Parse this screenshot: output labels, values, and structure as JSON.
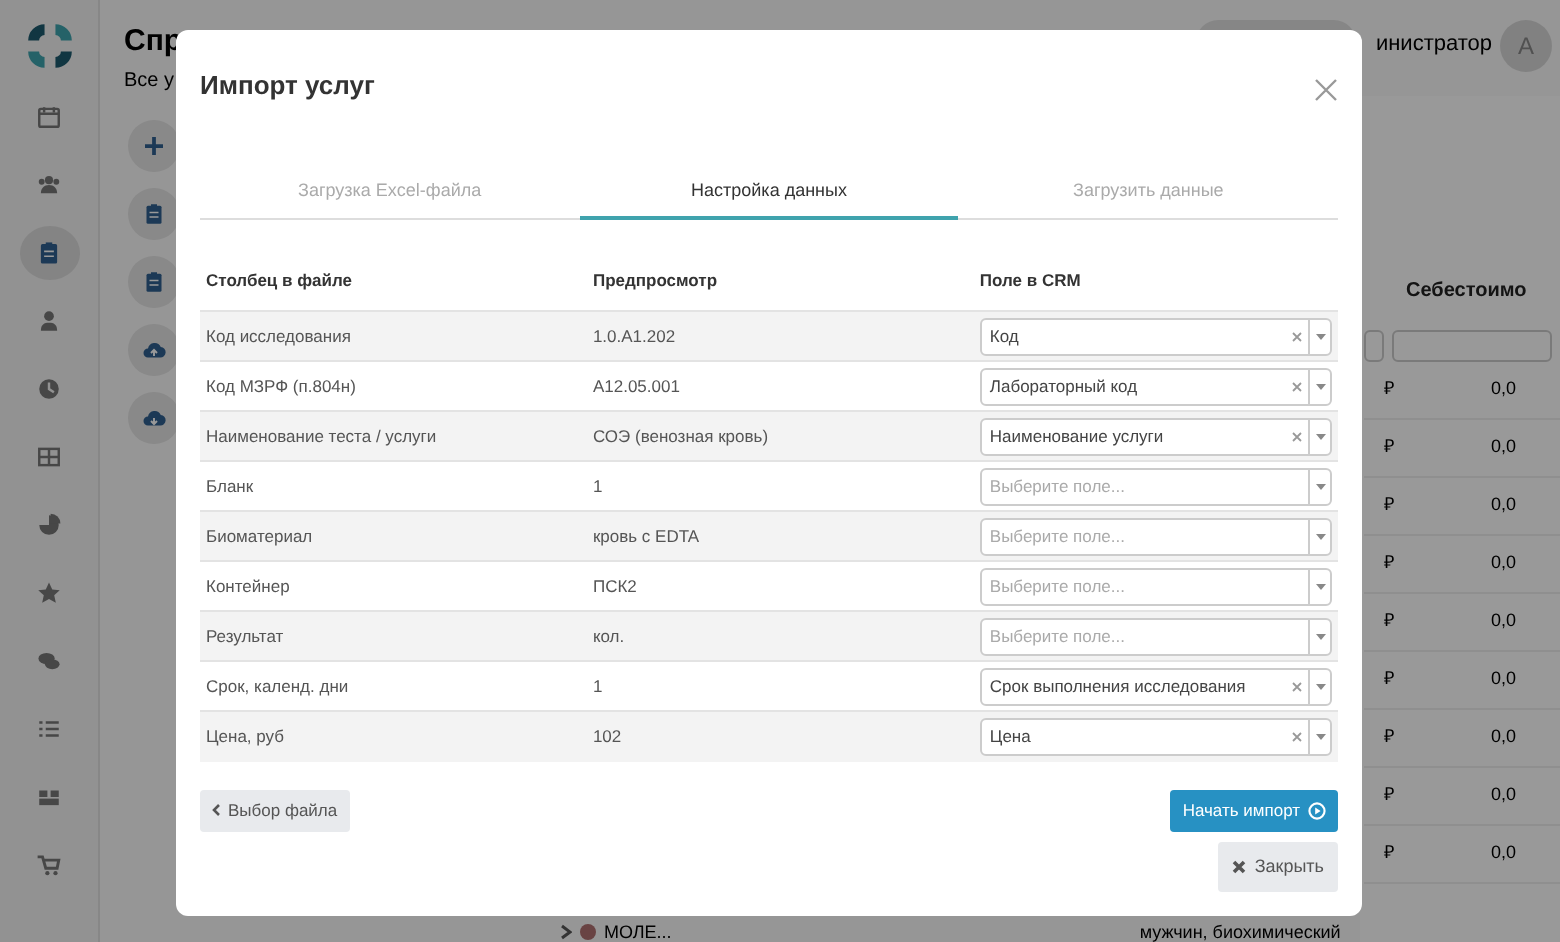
{
  "sidebar": {
    "items": [
      {
        "selected": false
      },
      {
        "selected": false
      },
      {
        "selected": true
      },
      {
        "selected": false
      },
      {
        "selected": false
      },
      {
        "selected": false
      },
      {
        "selected": false
      },
      {
        "selected": false
      },
      {
        "selected": false
      },
      {
        "selected": false
      },
      {
        "selected": false
      },
      {
        "selected": false
      }
    ]
  },
  "page": {
    "title": "Спр",
    "subtitle": "Все у"
  },
  "user": {
    "name": "инистратор",
    "avatar": "A"
  },
  "table": {
    "column_header": "Себестоимо",
    "rows": [
      {
        "currency": "₽",
        "value": "0,0"
      },
      {
        "currency": "₽",
        "value": "0,0"
      },
      {
        "currency": "₽",
        "value": "0,0"
      },
      {
        "currency": "₽",
        "value": "0,0"
      },
      {
        "currency": "₽",
        "value": "0,0"
      },
      {
        "currency": "₽",
        "value": "0,0"
      },
      {
        "currency": "₽",
        "value": "0,0"
      },
      {
        "currency": "₽",
        "value": "0,0"
      },
      {
        "currency": "₽",
        "value": "0,0"
      }
    ],
    "footer": {
      "tag": "МОЛЕ...",
      "description": "мужчин, биохимический"
    }
  },
  "modal": {
    "title": "Импорт услуг",
    "tabs": [
      {
        "label": "Загрузка Excel-файла",
        "selected": false
      },
      {
        "label": "Настройка данных",
        "selected": true
      },
      {
        "label": "Загрузить данные",
        "selected": false
      }
    ],
    "columns": [
      "Столбец в файле",
      "Предпросмотр",
      "Поле в CRM"
    ],
    "rows": [
      {
        "column": "Код исследования",
        "preview": "1.0.A1.202",
        "field": {
          "value": "Код"
        }
      },
      {
        "column": "Код МЗРФ (п.804н)",
        "preview": "A12.05.001",
        "field": {
          "value": "Лабораторный код"
        }
      },
      {
        "column": "Наименование теста / услуги",
        "preview": "СОЭ (венозная кровь)",
        "field": {
          "value": "Наименование услуги"
        }
      },
      {
        "column": "Бланк",
        "preview": "1",
        "field": {
          "placeholder": "Выберите поле..."
        }
      },
      {
        "column": "Биоматериал",
        "preview": "кровь с EDTA",
        "field": {
          "placeholder": "Выберите поле..."
        }
      },
      {
        "column": "Контейнер",
        "preview": "ПСК2",
        "field": {
          "placeholder": "Выберите поле..."
        }
      },
      {
        "column": "Результат",
        "preview": "кол.",
        "field": {
          "placeholder": "Выберите поле..."
        }
      },
      {
        "column": "Срок, календ. дни",
        "preview": "1",
        "field": {
          "value": "Срок выполнения исследования"
        }
      },
      {
        "column": "Цена, руб",
        "preview": "102",
        "field": {
          "value": "Цена"
        }
      }
    ],
    "back_button": "Выбор файла",
    "start_button": "Начать импорт",
    "close_button": "Закрыть"
  }
}
